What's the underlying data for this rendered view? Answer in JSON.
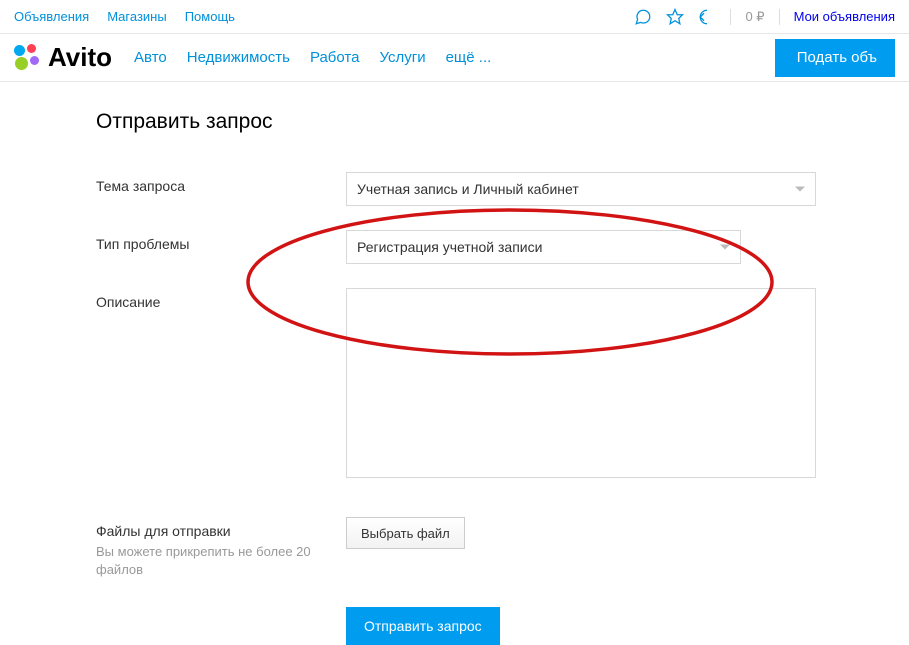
{
  "topbar": {
    "left": [
      "Объявления",
      "Магазины",
      "Помощь"
    ],
    "balance": "0 ₽",
    "my_ads": "Мои объявления"
  },
  "header": {
    "logo_text": "Avito",
    "nav": [
      "Авто",
      "Недвижимость",
      "Работа",
      "Услуги",
      "ещё ..."
    ],
    "post_btn": "Подать объ"
  },
  "form": {
    "title": "Отправить запрос",
    "topic_label": "Тема запроса",
    "topic_value": "Учетная запись и Личный кабинет",
    "problem_label": "Тип проблемы",
    "problem_value": "Регистрация учетной записи",
    "description_label": "Описание",
    "description_value": "",
    "files_label": "Файлы для отправки",
    "files_hint": "Вы можете прикрепить не более 20 файлов",
    "file_btn": "Выбрать файл",
    "submit": "Отправить запрос"
  }
}
